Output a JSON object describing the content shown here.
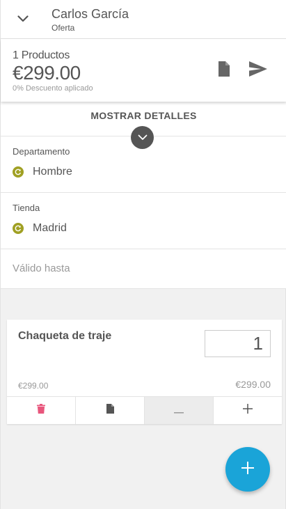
{
  "header": {
    "customer_name": "Carlos García",
    "subtitle": "Oferta"
  },
  "summary": {
    "products_count": "1 Productos",
    "total": "€299.00",
    "discount_note": "0% Descuento aplicado"
  },
  "details": {
    "toggle_label": "MOSTRAR DETALLES"
  },
  "fields": {
    "department_label": "Departamento",
    "department_value": "Hombre",
    "store_label": "Tienda",
    "store_value": "Madrid",
    "valid_until_placeholder": "Válido hasta"
  },
  "product": {
    "name": "Chaqueta de traje",
    "quantity": "1",
    "unit_price": "€299.00",
    "line_total": "€299.00"
  },
  "colors": {
    "accent": "#1aa4d8",
    "status_dot": "#a0a023",
    "delete": "#e8567c"
  },
  "icons": {
    "back": "chevron-down-icon",
    "document": "document-icon",
    "send": "send-icon",
    "toggle": "chevron-down-icon",
    "status": "refresh-icon",
    "delete": "trash-icon",
    "minus": "minus-icon",
    "plus": "plus-icon",
    "fab": "plus-icon"
  }
}
